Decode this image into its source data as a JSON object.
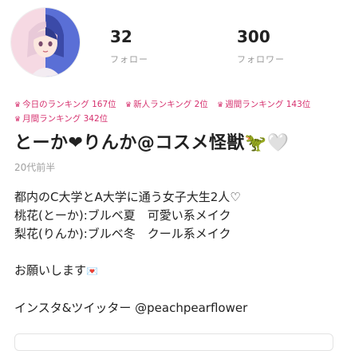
{
  "profile": {
    "follow_count": "32",
    "follow_label": "フォロー",
    "follower_count": "300",
    "follower_label": "フォロワー",
    "name": "とーか❤りんか@コスメ怪獣🦖🤍",
    "age": "20代前半"
  },
  "rankings": [
    {
      "label": "今日のランキング 167位"
    },
    {
      "label": "新人ランキング 2位"
    },
    {
      "label": "週間ランキング 143位"
    },
    {
      "label": "月間ランキング 342位"
    }
  ],
  "bio": {
    "line1": "都内のC大学とA大学に通う女子大生2人♡",
    "line2": "桃花(とーか):ブルベ夏　可愛い系メイク",
    "line3": "梨花(りんか):ブルベ冬　クール系メイク",
    "line4": "お願いします",
    "line4_icon": "💌",
    "line5": "インスタ&ツイッター @peachpearflower"
  },
  "icons": {
    "ranking_icon": "crown-icon"
  },
  "colors": {
    "accent": "#d6306e",
    "muted": "#9a9a9a"
  }
}
